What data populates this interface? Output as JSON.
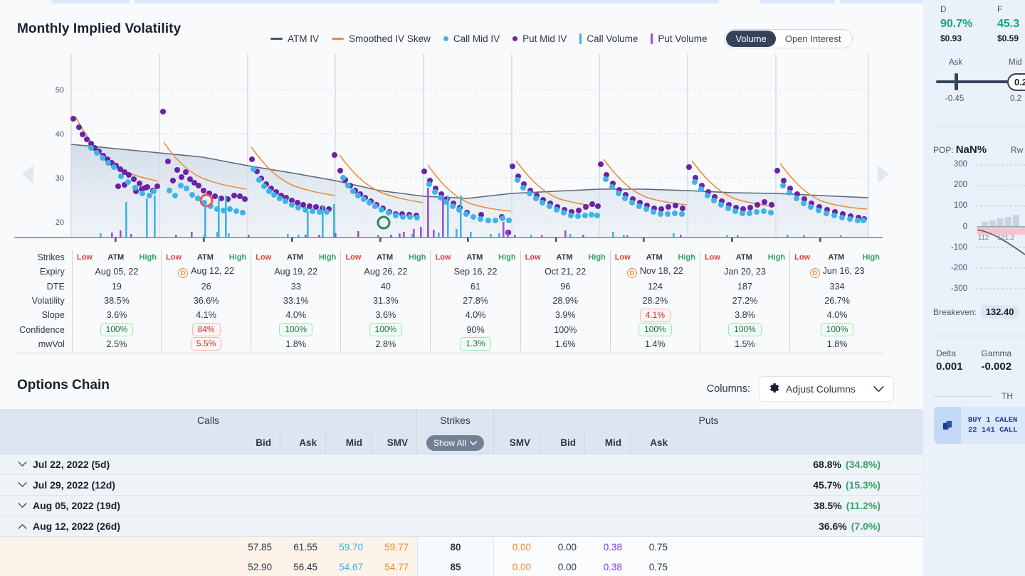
{
  "chart_panel": {
    "title": "Monthly Implied Volatility",
    "legend": [
      {
        "label": "ATM IV",
        "marker": "line",
        "color": "#4a5568"
      },
      {
        "label": "Smoothed IV Skew",
        "marker": "line",
        "color": "#ed8936"
      },
      {
        "label": "Call Mid IV",
        "marker": "dot",
        "color": "#3cb4e8"
      },
      {
        "label": "Put Mid IV",
        "marker": "dot",
        "color": "#6b21a8"
      },
      {
        "label": "Call Volume",
        "marker": "bar",
        "color": "#3cb4e8"
      },
      {
        "label": "Put Volume",
        "marker": "bar",
        "color": "#9f4fd6"
      }
    ],
    "toggle": {
      "options": [
        "Volume",
        "Open Interest"
      ],
      "selected": "Volume"
    },
    "nav": {
      "left": "prev-expiries",
      "right": "next-expiries"
    }
  },
  "chart_data": {
    "type": "scatter",
    "title": "Monthly Implied Volatility",
    "ylabel": "",
    "xlabel": "",
    "ylim": [
      14,
      56
    ],
    "yticks": [
      20,
      30,
      40,
      50
    ],
    "grid": true,
    "legend_position": "top-right",
    "series": [
      {
        "name": "ATM IV",
        "type": "line",
        "color": "#4a5568",
        "values": [
          38.5,
          36.6,
          33.1,
          31.3,
          27.8,
          28.9,
          28.2,
          27.2,
          26.7
        ]
      },
      {
        "name": "Smoothed IV Skew",
        "type": "line",
        "color": "#ed8936"
      },
      {
        "name": "Call Mid IV",
        "type": "scatter",
        "color": "#3cb4e8"
      },
      {
        "name": "Put Mid IV",
        "type": "scatter",
        "color": "#6b21a8"
      },
      {
        "name": "Call Volume",
        "type": "bar",
        "color": "#3cb4e8"
      },
      {
        "name": "Put Volume",
        "type": "bar",
        "color": "#9f4fd6"
      }
    ],
    "categories": [
      "Aug 05, 22",
      "Aug 12, 22",
      "Aug 19, 22",
      "Aug 26, 22",
      "Sep 16, 22",
      "Oct 21, 22",
      "Nov 18, 22",
      "Jan 20, 23",
      "Jun 16, 23"
    ],
    "markers": [
      {
        "label": "red-ring",
        "color": "#e53e3e",
        "x": 290,
        "y": 210
      },
      {
        "label": "green-ring",
        "color": "#2f855a",
        "x": 539,
        "y": 241
      }
    ]
  },
  "expiry_table": {
    "row_labels": [
      "Strikes",
      "Expiry",
      "DTE",
      "Volatility",
      "Slope",
      "Confidence",
      "mwVol"
    ],
    "strike_header": {
      "low": "Low",
      "atm": "ATM",
      "high": "High"
    },
    "columns": [
      {
        "expiry": "Aug 05, 22",
        "dividend": false,
        "dte": "19",
        "volatility": "38.5%",
        "slope": "3.6%",
        "slope_alert": false,
        "confidence": "100%",
        "confidence_state": "green",
        "mwvol": "2.5%",
        "mwvol_state": "none"
      },
      {
        "expiry": "Aug 12, 22",
        "dividend": true,
        "dte": "26",
        "volatility": "36.6%",
        "slope": "4.1%",
        "slope_alert": false,
        "confidence": "84%",
        "confidence_state": "red",
        "mwvol": "5.5%",
        "mwvol_state": "red"
      },
      {
        "expiry": "Aug 19, 22",
        "dividend": false,
        "dte": "33",
        "volatility": "33.1%",
        "slope": "4.0%",
        "slope_alert": false,
        "confidence": "100%",
        "confidence_state": "green",
        "mwvol": "1.8%",
        "mwvol_state": "none"
      },
      {
        "expiry": "Aug 26, 22",
        "dividend": false,
        "dte": "40",
        "volatility": "31.3%",
        "slope": "3.6%",
        "slope_alert": false,
        "confidence": "100%",
        "confidence_state": "green",
        "mwvol": "2.8%",
        "mwvol_state": "none"
      },
      {
        "expiry": "Sep 16, 22",
        "dividend": false,
        "dte": "61",
        "volatility": "27.8%",
        "slope": "4.0%",
        "slope_alert": false,
        "confidence": "90%",
        "confidence_state": "none",
        "mwvol": "1.3%",
        "mwvol_state": "green"
      },
      {
        "expiry": "Oct 21, 22",
        "dividend": false,
        "dte": "96",
        "volatility": "28.9%",
        "slope": "3.9%",
        "slope_alert": false,
        "confidence": "100%",
        "confidence_state": "none",
        "mwvol": "1.6%",
        "mwvol_state": "none"
      },
      {
        "expiry": "Nov 18, 22",
        "dividend": true,
        "dte": "124",
        "volatility": "28.2%",
        "slope": "4.1%",
        "slope_alert": true,
        "confidence": "100%",
        "confidence_state": "green",
        "mwvol": "1.4%",
        "mwvol_state": "none"
      },
      {
        "expiry": "Jan 20, 23",
        "dividend": false,
        "dte": "187",
        "volatility": "27.2%",
        "slope": "3.8%",
        "slope_alert": false,
        "confidence": "100%",
        "confidence_state": "green",
        "mwvol": "1.5%",
        "mwvol_state": "none"
      },
      {
        "expiry": "Jun 16, 23",
        "dividend": true,
        "dte": "334",
        "volatility": "26.7%",
        "slope": "4.0%",
        "slope_alert": false,
        "confidence": "100%",
        "confidence_state": "green",
        "mwvol": "1.8%",
        "mwvol_state": "none"
      }
    ]
  },
  "options_chain": {
    "title": "Options Chain",
    "columns_label": "Columns:",
    "adjust_columns_label": "Adjust Columns",
    "group_headers": {
      "calls": "Calls",
      "strikes": "Strikes",
      "puts": "Puts"
    },
    "show_all_label": "Show All",
    "call_columns": [
      "Bid",
      "Ask",
      "Mid",
      "SMV"
    ],
    "put_columns": [
      "SMV",
      "Bid",
      "Mid",
      "Ask"
    ],
    "expiry_rows": [
      {
        "label": "Jul 22, 2022 (5d)",
        "expanded": false,
        "iv": "68.8%",
        "change": "(34.8%)"
      },
      {
        "label": "Jul 29, 2022 (12d)",
        "expanded": false,
        "iv": "45.7%",
        "change": "(15.3%)"
      },
      {
        "label": "Aug 05, 2022 (19d)",
        "expanded": false,
        "iv": "38.5%",
        "change": "(11.2%)"
      },
      {
        "label": "Aug 12, 2022 (26d)",
        "expanded": true,
        "iv": "36.6%",
        "change": "(7.0%)"
      }
    ],
    "strike_rows": [
      {
        "call_bid": "57.85",
        "call_ask": "61.55",
        "call_mid": "59.70",
        "call_smv": "59.77",
        "strike": "80",
        "put_smv": "0.00",
        "put_bid": "0.00",
        "put_mid": "0.38",
        "put_ask": "0.75"
      },
      {
        "call_bid": "52.90",
        "call_ask": "56.45",
        "call_mid": "54.67",
        "call_smv": "54.77",
        "strike": "85",
        "put_smv": "0.00",
        "put_bid": "0.00",
        "put_mid": "0.38",
        "put_ask": "0.75"
      }
    ]
  },
  "sidebar": {
    "stats": [
      {
        "label": "D",
        "value": "90.7%",
        "sub": "$0.93"
      },
      {
        "label": "F",
        "value": "45.3",
        "sub": "$0.59"
      }
    ],
    "slider": {
      "left_label": "Ask",
      "right_label": "Mid",
      "left_value": "-0.45",
      "right_value": "0.2",
      "handle_value": "0.2"
    },
    "pop": {
      "label": "POP:",
      "value": "NaN%",
      "right_label": "Rw"
    },
    "payoff_axis": [
      "300",
      "200",
      "100",
      "0",
      "-100",
      "-200",
      "-300"
    ],
    "payoff_xlabels": [
      "112",
      "121.2"
    ],
    "breakeven": {
      "label": "Breakeven:",
      "value": "132.40"
    },
    "greeks": [
      {
        "label": "Delta",
        "value": "0.001"
      },
      {
        "label": "Gamma",
        "value": "-0.002"
      }
    ],
    "theta_label": "TH",
    "order": {
      "line1": "BUY 1 CALEN",
      "line2": "22 141 CALL"
    }
  }
}
